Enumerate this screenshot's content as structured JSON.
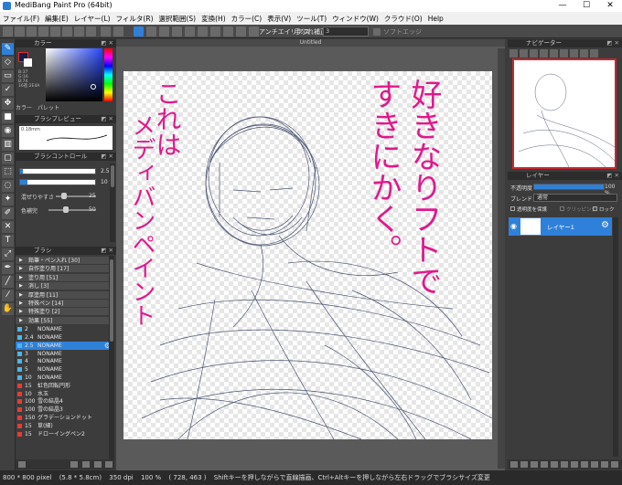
{
  "window": {
    "title": "MediBang Paint Pro (64bit)",
    "min": "—",
    "max": "☐",
    "close": "✕"
  },
  "menu": [
    "ファイル(F)",
    "編集(E)",
    "レイヤー(L)",
    "フィルタ(R)",
    "選択範囲(S)",
    "変換(H)",
    "カラー(C)",
    "表示(V)",
    "ツール(T)",
    "ウィンドウ(W)",
    "クラウド(O)",
    "Help"
  ],
  "toolbar": {
    "antialias": "アンチエイリアス",
    "correction": "手ぶれ補正",
    "correction_value": "3",
    "soft_edge": "ソフトエッジ"
  },
  "document_tab": "Untitled",
  "panels": {
    "color": {
      "title": "カラー",
      "tab_color": "カラー",
      "tab_palette": "パレット",
      "values": [
        "B:37",
        "G:16",
        "B:74",
        "16進:2E4A"
      ]
    },
    "brush_preview": {
      "title": "ブラシプレビュー",
      "size": "0.18mm"
    },
    "brush_control": {
      "title": "ブラシコントロール",
      "size_value": "2.5",
      "opacity_value": "10 %",
      "blend_label": "混ぜりやすさ",
      "blend_value": "25",
      "color_label": "色補完",
      "color_value": "50"
    },
    "brush": {
      "title": "ブラシ",
      "groups": [
        "鉛筆・ペン入れ [30]",
        "自作塗り用 [17]",
        "塗り用 [51]",
        "消し [3]",
        "厚塗用 [11]",
        "特殊ペン [14]",
        "特殊塗り [2]",
        "効果 [55]"
      ],
      "items": [
        {
          "size": "2",
          "name": "NONAME",
          "color": "#4ab6e8"
        },
        {
          "size": "2.4",
          "name": "NONAME",
          "color": "#4ab6e8"
        },
        {
          "size": "2.5",
          "name": "NONAME",
          "color": "#4ab6e8"
        },
        {
          "size": "3",
          "name": "NONAME",
          "color": "#4ab6e8"
        },
        {
          "size": "4",
          "name": "NONAME",
          "color": "#4ab6e8"
        },
        {
          "size": "5",
          "name": "NONAME",
          "color": "#4ab6e8"
        },
        {
          "size": "10",
          "name": "NONAME",
          "color": "#4ab6e8"
        },
        {
          "size": "15",
          "name": "虹色回転円形",
          "color": "#e83a3a"
        },
        {
          "size": "10",
          "name": "水玉",
          "color": "#e83a3a"
        },
        {
          "size": "100",
          "name": "雪の結晶4",
          "color": "#e83a3a"
        },
        {
          "size": "100",
          "name": "雪の結晶3",
          "color": "#e83a3a"
        },
        {
          "size": "150",
          "name": "グラデーションドット",
          "color": "#e83a3a"
        },
        {
          "size": "15",
          "name": "草(細)",
          "color": "#e83a3a"
        },
        {
          "size": "15",
          "name": "ドローイングペン2",
          "color": "#e83a3a"
        }
      ]
    },
    "navigator": {
      "title": "ナビゲーター"
    },
    "layer": {
      "title": "レイヤー",
      "opacity_label": "不透明度",
      "opacity_value": "100 %",
      "blend_label": "ブレンド",
      "blend_value": "通常",
      "protect": "透明度を保護",
      "clipping": "クリッピング",
      "lock": "ロック",
      "layer_name": "レイヤー1"
    }
  },
  "canvas_text": {
    "col1": "好きなりフトで",
    "col2": "すきにかく。",
    "col3": "これは",
    "col4": "メディバンペイント"
  },
  "status": {
    "size": "800 * 800 pixel",
    "physical": "(5.8 * 5.8cm)",
    "dpi": "350 dpi",
    "zoom": "100 %",
    "coords": "( 728, 463 )",
    "hint": "Shiftキーを押しながらで直線描画、Ctrl+Altキーを押しながら左右ドラッグでブラシサイズ変更"
  },
  "colors": {
    "accent": "#2f80d8",
    "selected_brush": "#2f80d8",
    "ink": "#e0198c",
    "stroke": "#2e3a5c"
  }
}
